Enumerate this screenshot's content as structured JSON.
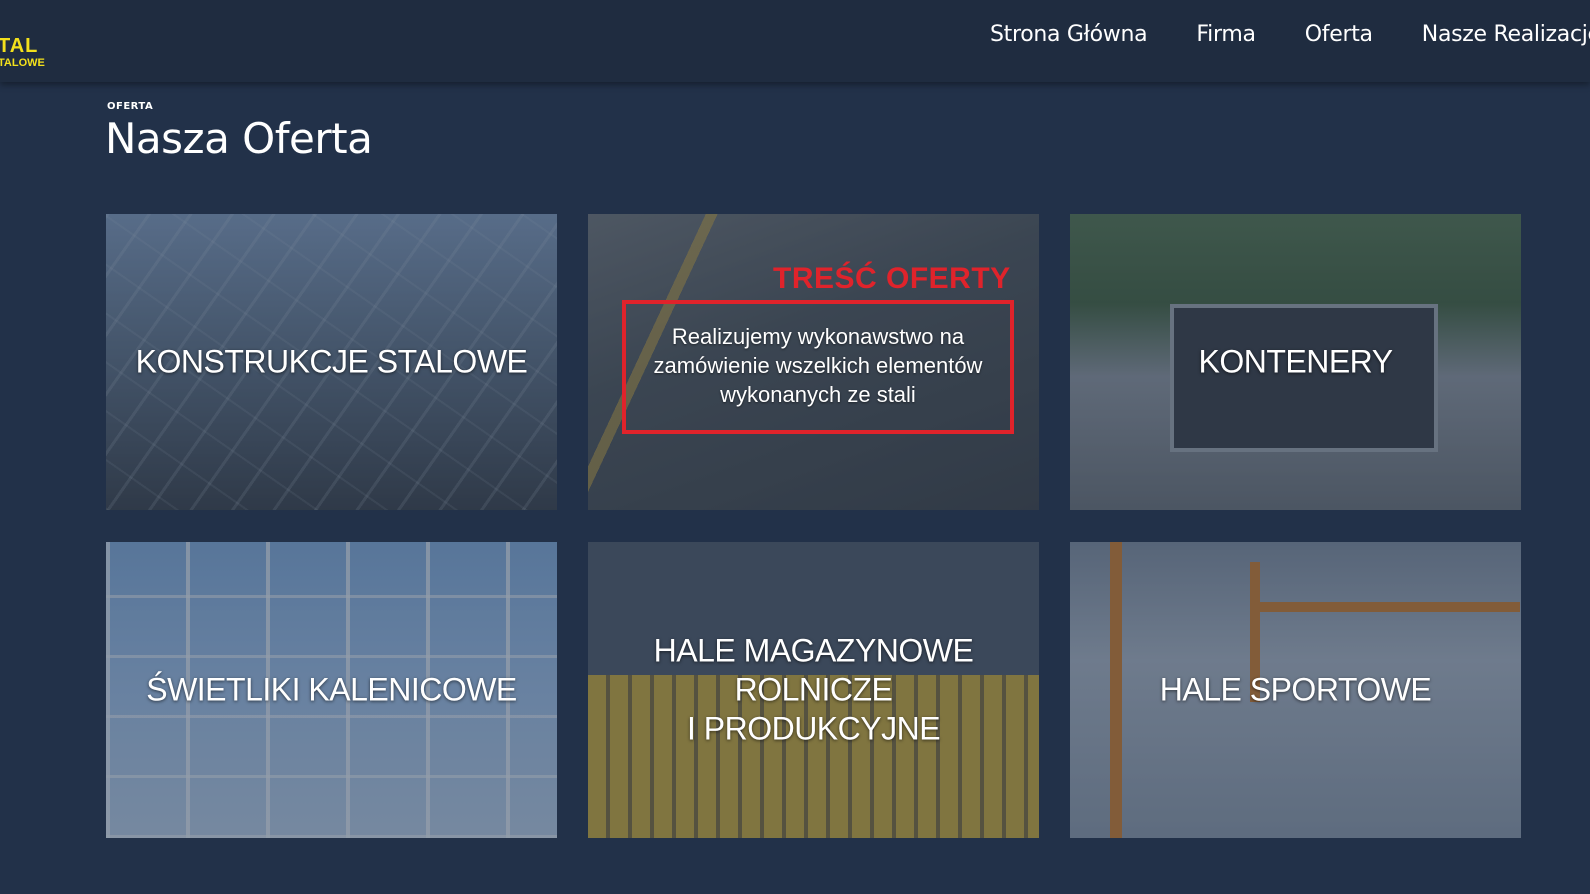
{
  "header": {
    "logo_main": "TAL",
    "logo_sub": "TALOWE",
    "nav": [
      {
        "label": "Strona Główna"
      },
      {
        "label": "Firma"
      },
      {
        "label": "Oferta"
      },
      {
        "label": "Nasze Realizacje"
      }
    ]
  },
  "section": {
    "eyebrow": "OFERTA",
    "title": "Nasza Oferta"
  },
  "cards": [
    {
      "title": "KONSTRUKCJE STALOWE"
    },
    {
      "title": ""
    },
    {
      "title": "KONTENERY"
    },
    {
      "title": "ŚWIETLIKI KALENICOWE"
    },
    {
      "title": "HALE MAGAZYNOWE\nROLNICZE\nI PRODUKCYJNE"
    },
    {
      "title": "HALE SPORTOWE"
    }
  ],
  "annotation": {
    "label": "TREŚĆ OFERTY",
    "text": "Realizujemy wykonawstwo na zamówienie wszelkich elementów wykonanych ze stali",
    "color": "#e0232b"
  },
  "colors": {
    "background": "#223149",
    "header": "#1f2c40",
    "logo": "#f2e01c"
  }
}
